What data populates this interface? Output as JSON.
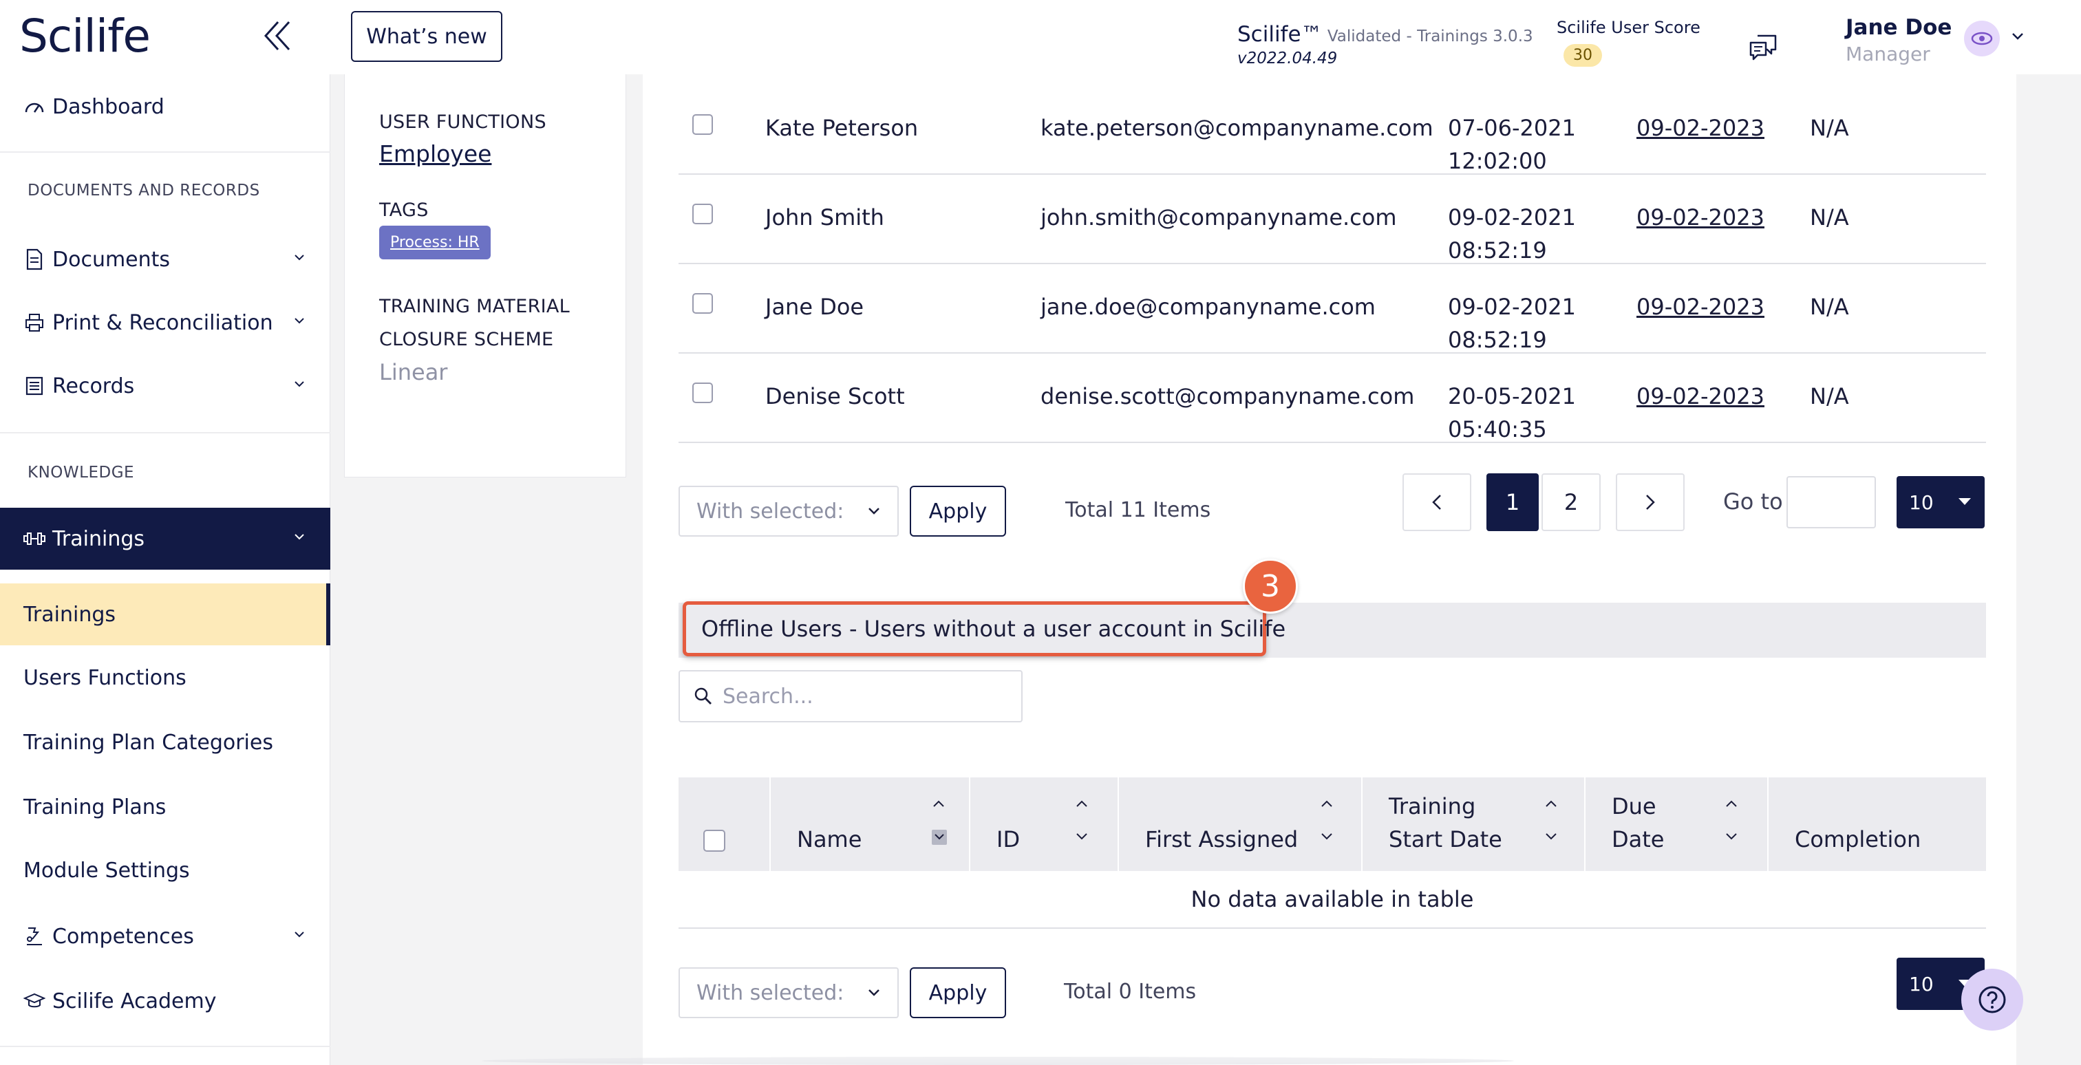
{
  "header": {
    "logo": "Scilife",
    "whats_new": "What’s new",
    "product_name": "Scilife™",
    "validated": " Validated - Trainings 3.0.3",
    "version": "v2022.04.49",
    "score_label": "Scilife User Score",
    "score_value": "30",
    "user_name": "Jane Doe",
    "user_role": "Manager"
  },
  "sidebar": {
    "dashboard": "Dashboard",
    "section_docs": "DOCUMENTS AND RECORDS",
    "documents": "Documents",
    "print": "Print & Reconciliation",
    "records": "Records",
    "section_knowledge": "KNOWLEDGE",
    "trainings_parent": "Trainings",
    "sub": {
      "trainings": "Trainings",
      "users_functions": "Users Functions",
      "training_plan_categories": "Training Plan Categories",
      "training_plans": "Training Plans",
      "module_settings": "Module Settings"
    },
    "competences": "Competences",
    "academy": "Scilife Academy"
  },
  "info_card": {
    "user_functions_label": "USER FUNCTIONS",
    "user_functions_value": "Employee",
    "tags_label": "TAGS",
    "tag": "Process: HR",
    "closure_label_1": "TRAINING MATERIAL",
    "closure_label_2": "CLOSURE SCHEME",
    "closure_value": "Linear"
  },
  "users_table": {
    "rows": [
      {
        "name": "Kate Peterson",
        "email": "kate.peterson@companyname.com",
        "date": "07-06-2021",
        "time": "12:02:00",
        "due": "09-02-2023",
        "completion": "N/A"
      },
      {
        "name": "John Smith",
        "email": "john.smith@companyname.com",
        "date": "09-02-2021",
        "time": "08:52:19",
        "due": "09-02-2023",
        "completion": "N/A"
      },
      {
        "name": "Jane Doe",
        "email": "jane.doe@companyname.com",
        "date": "09-02-2021",
        "time": "08:52:19",
        "due": "09-02-2023",
        "completion": "N/A"
      },
      {
        "name": "Denise Scott",
        "email": "denise.scott@companyname.com",
        "date": "20-05-2021",
        "time": "05:40:35",
        "due": "09-02-2023",
        "completion": "N/A"
      }
    ],
    "with_selected": "With selected:",
    "apply": "Apply",
    "total": "Total 11 Items",
    "pages": [
      "1",
      "2"
    ],
    "goto_label": "Go to",
    "per_page": "10"
  },
  "offline": {
    "step": "3",
    "title": "Offline Users - Users without a user account in Scilife",
    "search_placeholder": "Search...",
    "columns": {
      "name": "Name",
      "id": "ID",
      "first_assigned": "First Assigned",
      "training_start_1": "Training",
      "training_start_2": "Start Date",
      "due_1": "Due",
      "due_2": "Date",
      "completion": "Completion"
    },
    "no_data": "No data available in table",
    "with_selected": "With selected:",
    "apply": "Apply",
    "total": "Total 0 Items",
    "per_page": "10"
  },
  "colors": {
    "navy": "#121a45",
    "highlight": "#fdeab9",
    "annotation": "#e9643f",
    "tag": "#6c72c4"
  },
  "icons": [
    "collapse-icon",
    "chat-icon",
    "avatar-icon",
    "dashboard-icon",
    "document-icon",
    "print-icon",
    "records-icon",
    "trainings-icon",
    "competences-icon",
    "academy-icon",
    "search-icon",
    "help-icon"
  ]
}
